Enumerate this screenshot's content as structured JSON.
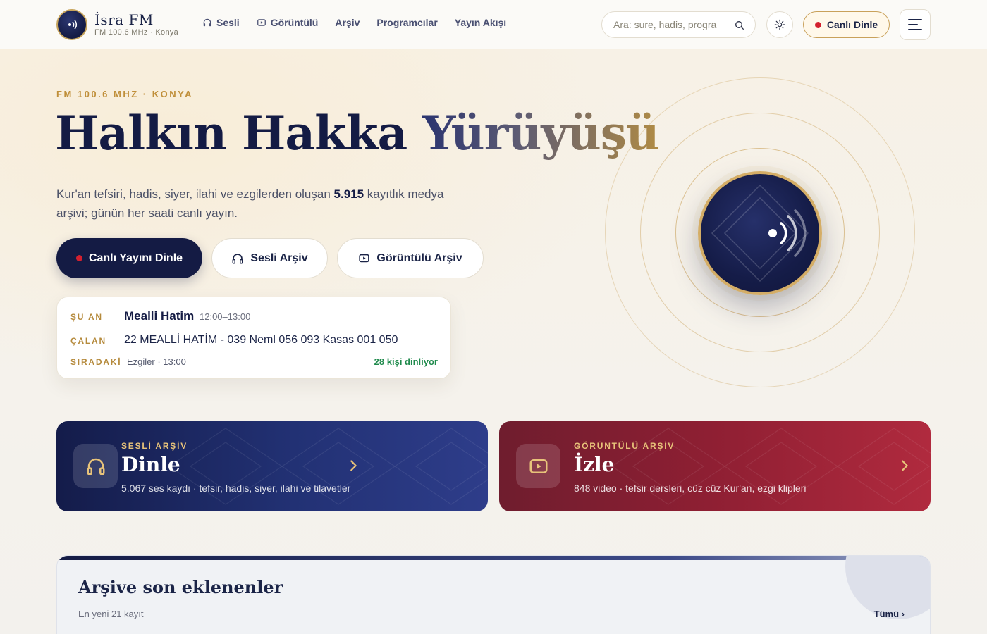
{
  "brand": {
    "title": "İsra FM",
    "subtitle": "FM 100.6 MHz · Konya"
  },
  "nav": [
    {
      "label": "Sesli",
      "icon": "headphones-icon"
    },
    {
      "label": "Görüntülü",
      "icon": "play-square-icon"
    },
    {
      "label": "Arşiv"
    },
    {
      "label": "Programcılar"
    },
    {
      "label": "Yayın Akışı"
    }
  ],
  "search": {
    "placeholder": "Ara: sure, hadis, progra",
    "value": ""
  },
  "header": {
    "live_label": "Canlı Dinle"
  },
  "hero": {
    "eyebrow": "FM 100.6 MHZ · KONYA",
    "title_part1": "Halkın Hakka",
    "title_part2": "Yürüyüşü",
    "desc_before": "Kur'an tefsiri, hadis, siyer, ilahi ve ezgilerden oluşan ",
    "desc_count": "5.915",
    "desc_after": " kayıtlık medya arşivi; günün her saati canlı yayın.",
    "cta_live": "Canlı Yayını Dinle",
    "cta_audio": "Sesli Arşiv",
    "cta_video": "Görüntülü Arşiv"
  },
  "now_playing": {
    "now_label": "ŞU AN",
    "program": "Mealli Hatim",
    "time": "12:00–13:00",
    "playing_label": "ÇALAN",
    "track": "22 MEALLİ HATİM - 039 Neml 056 093 Kasas 001 050",
    "next_label": "SIRADAKİ",
    "next": "Ezgiler · 13:00",
    "listeners": "28 kişi dinliyor"
  },
  "archive_cards": {
    "audio": {
      "eyebrow": "SESLİ ARŞİV",
      "title": "Dinle",
      "desc": "5.067 ses kaydı · tefsir, hadis, siyer, ilahi ve tilavetler"
    },
    "video": {
      "eyebrow": "GÖRÜNTÜLÜ ARŞİV",
      "title": "İzle",
      "desc": "848 video · tefsir dersleri, cüz cüz Kur'an, ezgi klipleri"
    }
  },
  "recent": {
    "title": "Arşive son eklenenler",
    "subtitle": "En yeni 21 kayıt",
    "all_link": "Tümü ›"
  },
  "colors": {
    "navy": "#141b44",
    "gold": "#c9a15a",
    "live_red": "#d3202f",
    "listeners_green": "#1f8a4c",
    "video_red": "#9b2236"
  }
}
